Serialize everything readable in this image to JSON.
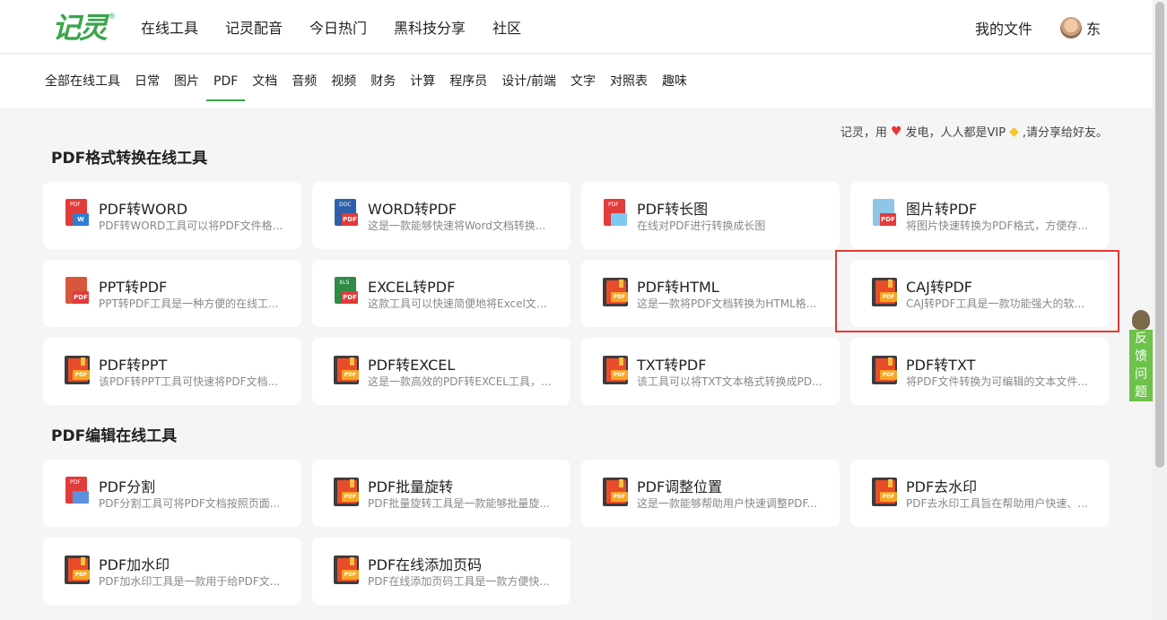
{
  "logo": {
    "text": "记灵",
    "reg": "®"
  },
  "mainnav": [
    "在线工具",
    "记灵配音",
    "今日热门",
    "黑科技分享",
    "社区"
  ],
  "user": {
    "my_files": "我的文件",
    "name": "东"
  },
  "catnav": [
    "全部在线工具",
    "日常",
    "图片",
    "PDF",
    "文档",
    "音频",
    "视频",
    "财务",
    "计算",
    "程序员",
    "设计/前端",
    "文字",
    "对照表",
    "趣味"
  ],
  "notice": {
    "prefix": "记灵，用",
    "mid": "发电，人人都是VIP",
    "suffix": ",请分享给好友。"
  },
  "sections": {
    "convert": {
      "title": "PDF格式转换在线工具",
      "cards": [
        {
          "title": "PDF转WORD",
          "desc": "PDF转WORD工具可以将PDF文件格..."
        },
        {
          "title": "WORD转PDF",
          "desc": "这是一款能够快速将Word文档转换..."
        },
        {
          "title": "PDF转长图",
          "desc": "在线对PDF进行转换成长图"
        },
        {
          "title": "图片转PDF",
          "desc": "将图片快速转换为PDF格式，方便存..."
        },
        {
          "title": "PPT转PDF",
          "desc": "PPT转PDF工具是一种方便的在线工..."
        },
        {
          "title": "EXCEL转PDF",
          "desc": "这款工具可以快速简便地将Excel文件..."
        },
        {
          "title": "PDF转HTML",
          "desc": "这是一款将PDF文档转换为HTML格..."
        },
        {
          "title": "CAJ转PDF",
          "desc": "CAJ转PDF工具是一款功能强大的软..."
        },
        {
          "title": "PDF转PPT",
          "desc": "该PDF转PPT工具可快速将PDF文档..."
        },
        {
          "title": "PDF转EXCEL",
          "desc": "这是一款高效的PDF转EXCEL工具，..."
        },
        {
          "title": "TXT转PDF",
          "desc": "该工具可以将TXT文本格式转换成PD..."
        },
        {
          "title": "PDF转TXT",
          "desc": "将PDF文件转换为可编辑的文本文件..."
        }
      ]
    },
    "edit": {
      "title": "PDF编辑在线工具",
      "cards": [
        {
          "title": "PDF分割",
          "desc": "PDF分割工具可将PDF文档按照页面..."
        },
        {
          "title": "PDF批量旋转",
          "desc": "PDF批量旋转工具是一款能够批量旋..."
        },
        {
          "title": "PDF调整位置",
          "desc": "这是一款能够帮助用户快速调整PDF..."
        },
        {
          "title": "PDF去水印",
          "desc": "PDF去水印工具旨在帮助用户快速、..."
        },
        {
          "title": "PDF加水印",
          "desc": "PDF加水印工具是一款用于给PDF文..."
        },
        {
          "title": "PDF在线添加页码",
          "desc": "PDF在线添加页码工具是一款方便快..."
        }
      ]
    }
  },
  "icon_tags": {
    "pdf": "PDF",
    "w": "W",
    "doc": "DOC",
    "xls": "XLS"
  },
  "feedback": [
    "反",
    "馈",
    "问",
    "题"
  ],
  "colors": {
    "brand_green": "#3aa54c",
    "highlight_red": "#e53935",
    "pdf_red": "#e84c2b",
    "feedback_green": "#6cc24a"
  }
}
